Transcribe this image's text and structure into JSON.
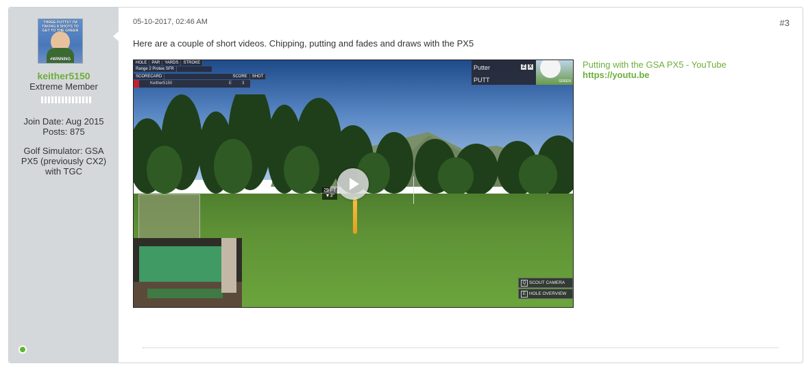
{
  "author": {
    "username": "keither5150",
    "title": "Extreme Member",
    "join_date": "Join Date: Aug 2015",
    "posts": "Posts: 875",
    "golf_simulator": "Golf Simulator: GSA PX5 (previously CX2) with TGC",
    "avatar_caption_top": "THREE PUTTS? I'M TAKING 8 SHOTS TO GET TO THE GREEN",
    "avatar_caption_bottom": "#WINNING",
    "status_color": "#5cb72a"
  },
  "post": {
    "date": "05-10-2017, 02:46 AM",
    "number": "#3",
    "message": "Here are a couple of short videos. Chipping, putting and fades and draws with the PX5"
  },
  "video": {
    "hud": {
      "col_hole": "HOLE",
      "col_par": "PAR",
      "col_yards": "YARDS",
      "col_stroke": "STROKE",
      "course": "Range 2 Protee SFR",
      "scoreboard": "SCORECARD",
      "score": "SCORE",
      "shot": "SHOT",
      "player": "Keither5150",
      "score_value": "E",
      "shot_value": "3",
      "club": "Putter",
      "shot_type": "PUTT",
      "key1": "Z",
      "key2": "X",
      "lie": "GREEN",
      "distance": "25 FT",
      "elevation": "▼3\"",
      "scout_key": "Q",
      "scout_label": "SCOUT CAMERA",
      "overview_key": "E",
      "overview_label": "HOLE OVERVIEW"
    }
  },
  "link": {
    "title": "Putting with the GSA PX5 - YouTube",
    "url": "https://youtu.be"
  },
  "colors": {
    "accent_green": "#6cae3a",
    "sidebar_bg": "#d5d8db"
  }
}
